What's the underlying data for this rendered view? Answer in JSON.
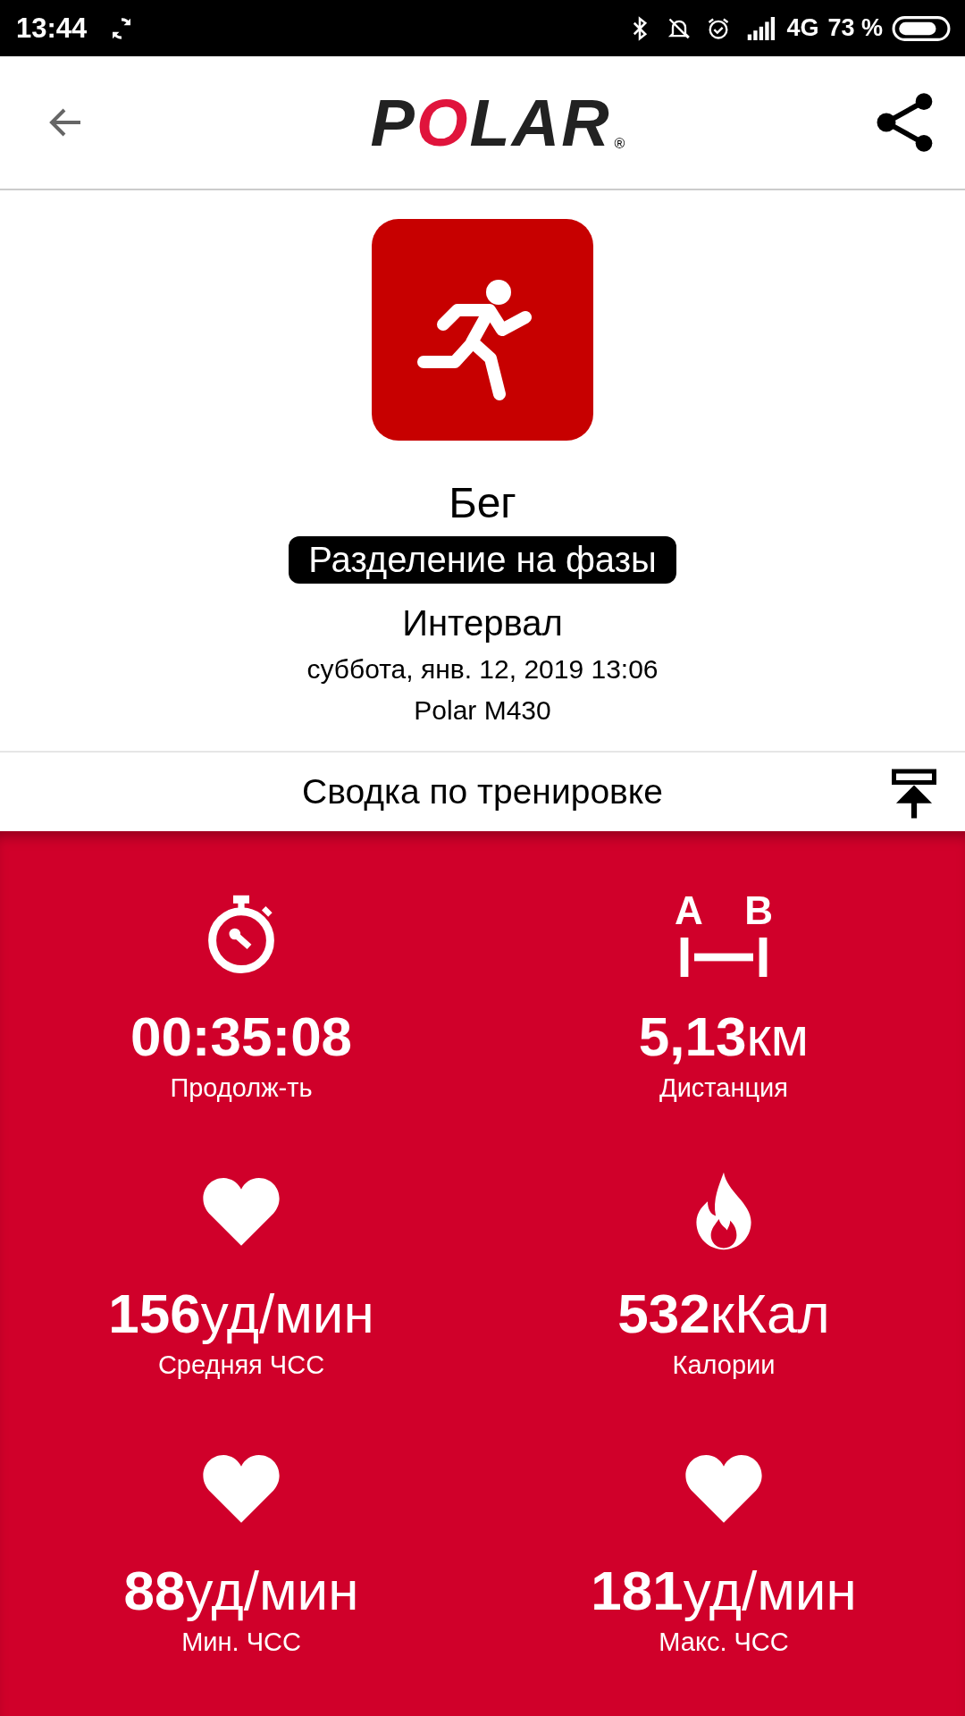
{
  "status_bar": {
    "time": "13:44",
    "network": "4G",
    "battery": "73 %"
  },
  "header": {
    "logo": "POLAR",
    "logo_mark": "®"
  },
  "activity": {
    "sport": "Бег",
    "badge": "Разделение на фазы",
    "phase": "Интервал",
    "date": "суббота, янв. 12, 2019 13:06",
    "device": "Polar M430"
  },
  "summary": {
    "title": "Сводка по тренировке"
  },
  "stats": [
    {
      "kind": "duration",
      "value": "00:35:08",
      "label": "Продолж-ть"
    },
    {
      "kind": "distance",
      "value": "5,13",
      "unit": "км",
      "label": "Дистанция"
    },
    {
      "kind": "heart",
      "value": "156",
      "unit": "уд/мин",
      "label": "Средняя ЧСС"
    },
    {
      "kind": "calories",
      "value": "532",
      "unit": "кКал",
      "label": "Калории"
    },
    {
      "kind": "heart",
      "value": "88",
      "unit": "уд/мин",
      "label": "Мин. ЧСС"
    },
    {
      "kind": "heart",
      "value": "181",
      "unit": "уд/мин",
      "label": "Макс. ЧСС"
    }
  ],
  "distance_icon_letters": [
    "A",
    "B"
  ]
}
